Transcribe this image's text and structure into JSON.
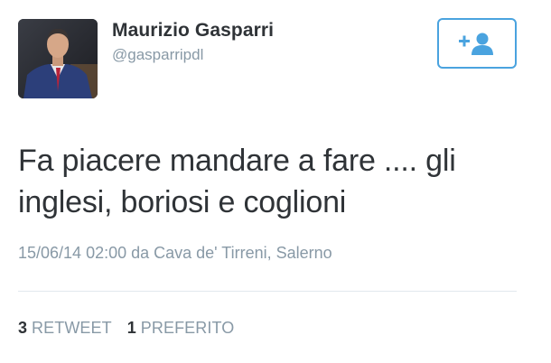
{
  "user": {
    "display_name": "Maurizio Gasparri",
    "handle": "@gasparripdl"
  },
  "follow_button": {
    "icon": "add-user-icon",
    "color": "#4aa3df"
  },
  "tweet": {
    "text": "Fa piacere mandare a fare .... gli inglesi, boriosi e coglioni",
    "timestamp_location": "15/06/14 02:00 da Cava de' Tirreni, Salerno"
  },
  "stats": {
    "retweets_count": "3",
    "retweets_label": "RETWEET",
    "favorites_count": "1",
    "favorites_label": "PREFERITO"
  },
  "colors": {
    "text": "#2f3337",
    "muted": "#8899a6",
    "accent": "#4aa3df",
    "divider": "#e1e8ed"
  }
}
